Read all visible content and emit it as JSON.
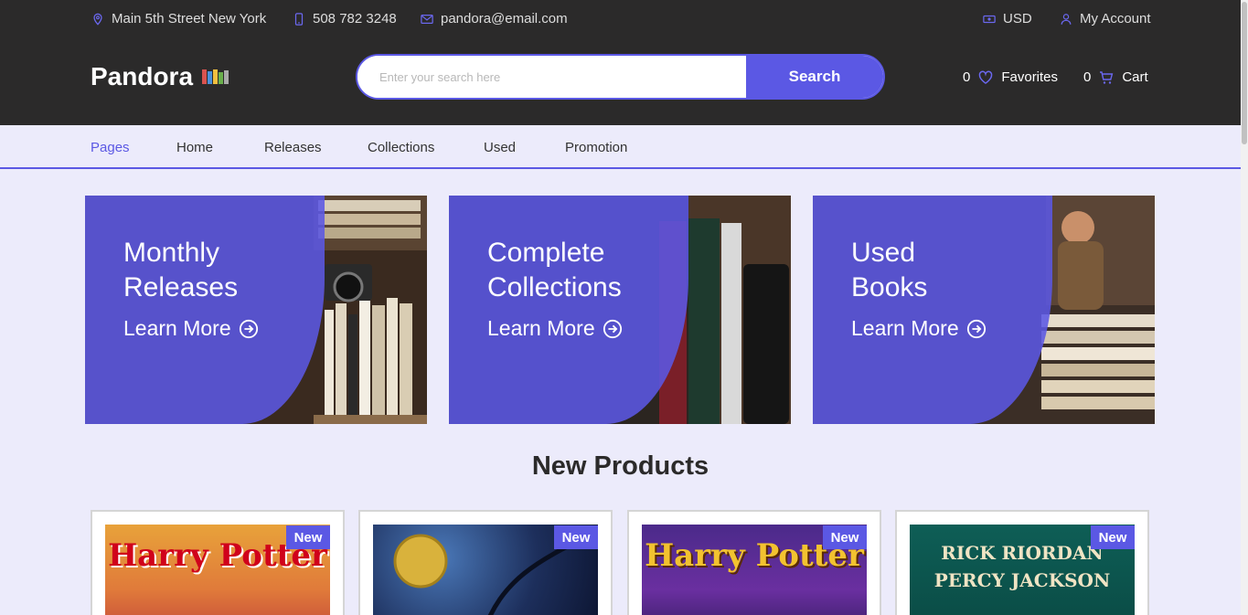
{
  "topbar": {
    "address": "Main 5th Street New York",
    "phone": "508 782 3248",
    "email": "pandora@email.com",
    "currency": "USD",
    "account": "My Account"
  },
  "header": {
    "logo": "Pandora",
    "search_placeholder": "Enter your search here",
    "search_button": "Search",
    "favorites_count": "0",
    "favorites_label": "Favorites",
    "cart_count": "0",
    "cart_label": "Cart"
  },
  "nav": [
    "Pages",
    "Home",
    "Releases",
    "Collections",
    "Used",
    "Promotion"
  ],
  "banners": [
    {
      "title": "Monthly\nReleases",
      "cta": "Learn More"
    },
    {
      "title": "Complete\nCollections",
      "cta": "Learn More"
    },
    {
      "title": "Used\nBooks",
      "cta": "Learn More"
    }
  ],
  "section_title": "New Products",
  "products": [
    {
      "badge": "New",
      "cover_text": "Harry Potter"
    },
    {
      "badge": "New",
      "cover_text": ""
    },
    {
      "badge": "New",
      "cover_text": "Harry Potter"
    },
    {
      "badge": "New",
      "cover_text": "RICK RIORDAN PERCY JACKSON"
    }
  ],
  "colors": {
    "accent": "#5b58e4",
    "header_bg": "#2b2a2a",
    "page_bg": "#ecebfb"
  }
}
